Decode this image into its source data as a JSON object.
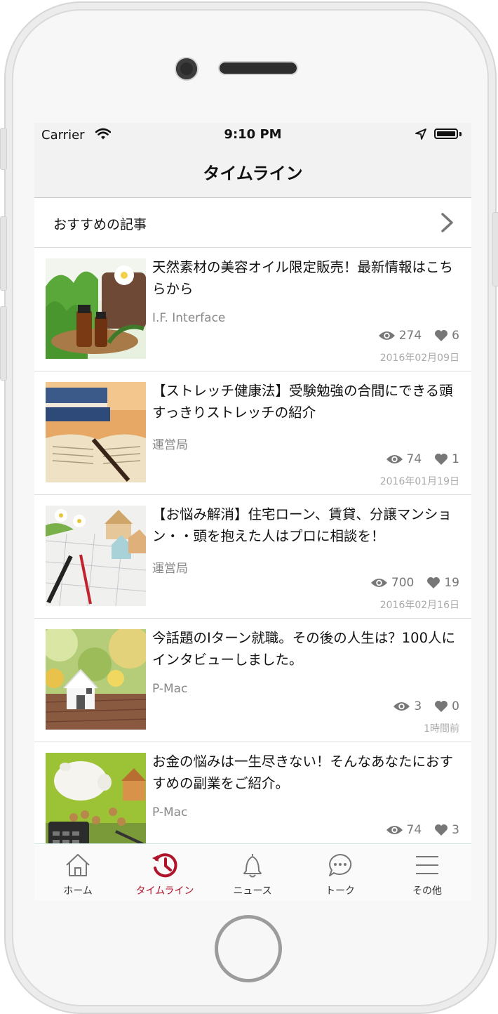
{
  "status_bar": {
    "carrier": "Carrier",
    "time": "9:10 PM"
  },
  "nav": {
    "title": "タイムライン"
  },
  "featured": {
    "label": "おすすめの記事"
  },
  "articles": [
    {
      "title": "天然素材の美容オイル限定販売！最新情報はこちらから",
      "author": "I.F. Interface",
      "views": "274",
      "likes": "6",
      "date": "2016年02月09日",
      "thumbnail": "aroma-oil-photo"
    },
    {
      "title": "【ストレッチ健康法】受験勉強の合間にできる頭すっきりストレッチの紹介",
      "author": "運営局",
      "views": "74",
      "likes": "1",
      "date": "2016年01月19日",
      "thumbnail": "open-book-photo"
    },
    {
      "title": "【お悩み解消】住宅ローン、賃貸、分譲マンション・・頭を抱えた人はプロに相談を！",
      "author": "運営局",
      "views": "700",
      "likes": "19",
      "date": "2016年02月16日",
      "thumbnail": "house-blueprint-photo"
    },
    {
      "title": "今話題のIターン就職。その後の人生は？100人にインタビューしました。",
      "author": "P-Mac",
      "views": "3",
      "likes": "0",
      "date": "1時間前",
      "thumbnail": "small-house-photo"
    },
    {
      "title": "お金の悩みは一生尽きない！そんなあなたにおすすめの副業をご紹介。",
      "author": "P-Mac",
      "views": "74",
      "likes": "3",
      "date": "",
      "thumbnail": "piggy-bank-photo"
    }
  ],
  "tabs": [
    {
      "label": "ホーム",
      "icon": "house-icon"
    },
    {
      "label": "タイムライン",
      "icon": "history-clock-icon",
      "active": true
    },
    {
      "label": "ニュース",
      "icon": "bell-icon"
    },
    {
      "label": "トーク",
      "icon": "chat-bubble-icon"
    },
    {
      "label": "その他",
      "icon": "menu-icon"
    }
  ],
  "colors": {
    "accent": "#b0142b",
    "tab_border": "#ccebe6",
    "nav_bg": "#f2f2f2"
  }
}
